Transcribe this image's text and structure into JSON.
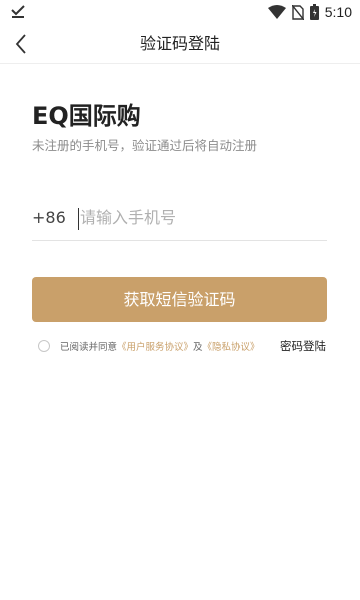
{
  "status_bar": {
    "time": "5:10"
  },
  "nav": {
    "title": "验证码登陆"
  },
  "brand": {
    "title": "EQ国际购",
    "subtitle": "未注册的手机号，验证通过后将自动注册"
  },
  "phone": {
    "country_code": "+86",
    "placeholder": "请输入手机号"
  },
  "primary_button": {
    "label": "获取短信验证码"
  },
  "agreement": {
    "prefix": "已阅读并同意",
    "user_agreement": "《用户服务协议》",
    "conjunction": "及",
    "privacy_policy": "《隐私协议》",
    "checked": false
  },
  "password_login": {
    "label": "密码登陆"
  },
  "colors": {
    "accent": "#c9a06a",
    "text": "#222222",
    "muted": "#8c8c8c"
  },
  "icons": [
    "download-done-icon",
    "wifi-icon",
    "no-sim-icon",
    "battery-icon",
    "back-arrow-icon"
  ]
}
